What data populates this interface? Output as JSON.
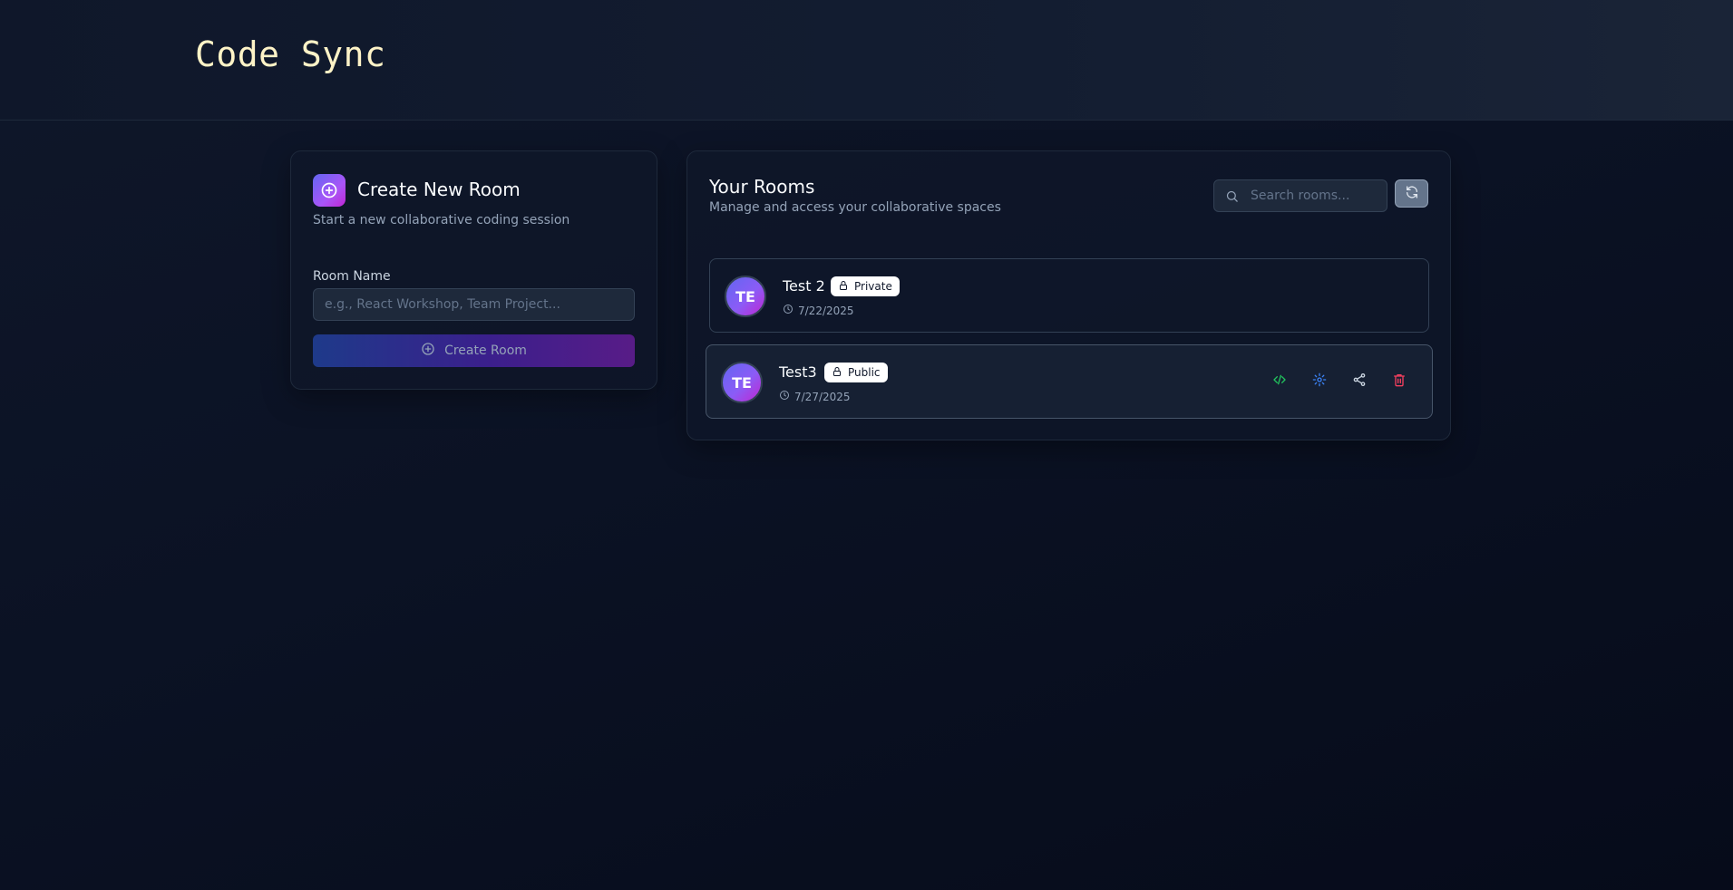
{
  "app": {
    "brand": "Code Sync"
  },
  "create": {
    "title": "Create New Room",
    "subtitle": "Start a new collaborative coding session",
    "room_name_label": "Room Name",
    "room_name_placeholder": "e.g., React Workshop, Team Project...",
    "room_name_value": "",
    "create_button_label": "Create Room"
  },
  "rooms": {
    "title": "Your Rooms",
    "subtitle": "Manage and access your collaborative spaces",
    "search_placeholder": "Search rooms...",
    "search_value": "",
    "list": [
      {
        "initials": "TE",
        "name": "Test 2",
        "visibility": "Private",
        "date": "7/22/2025"
      },
      {
        "initials": "TE",
        "name": "Test3",
        "visibility": "Public",
        "date": "7/27/2025"
      }
    ]
  },
  "colors": {
    "accent_green": "#22c55e",
    "accent_blue": "#3b82f6",
    "accent_red": "#f43f5e",
    "brand_text": "#fef3c7"
  },
  "icons": {
    "create": "plus-circle-icon",
    "search": "search-icon",
    "refresh": "refresh-icon",
    "lock": "lock-icon",
    "clock": "clock-icon",
    "code": "code-icon",
    "settings": "gear-icon",
    "share": "share-icon",
    "delete": "trash-icon"
  }
}
